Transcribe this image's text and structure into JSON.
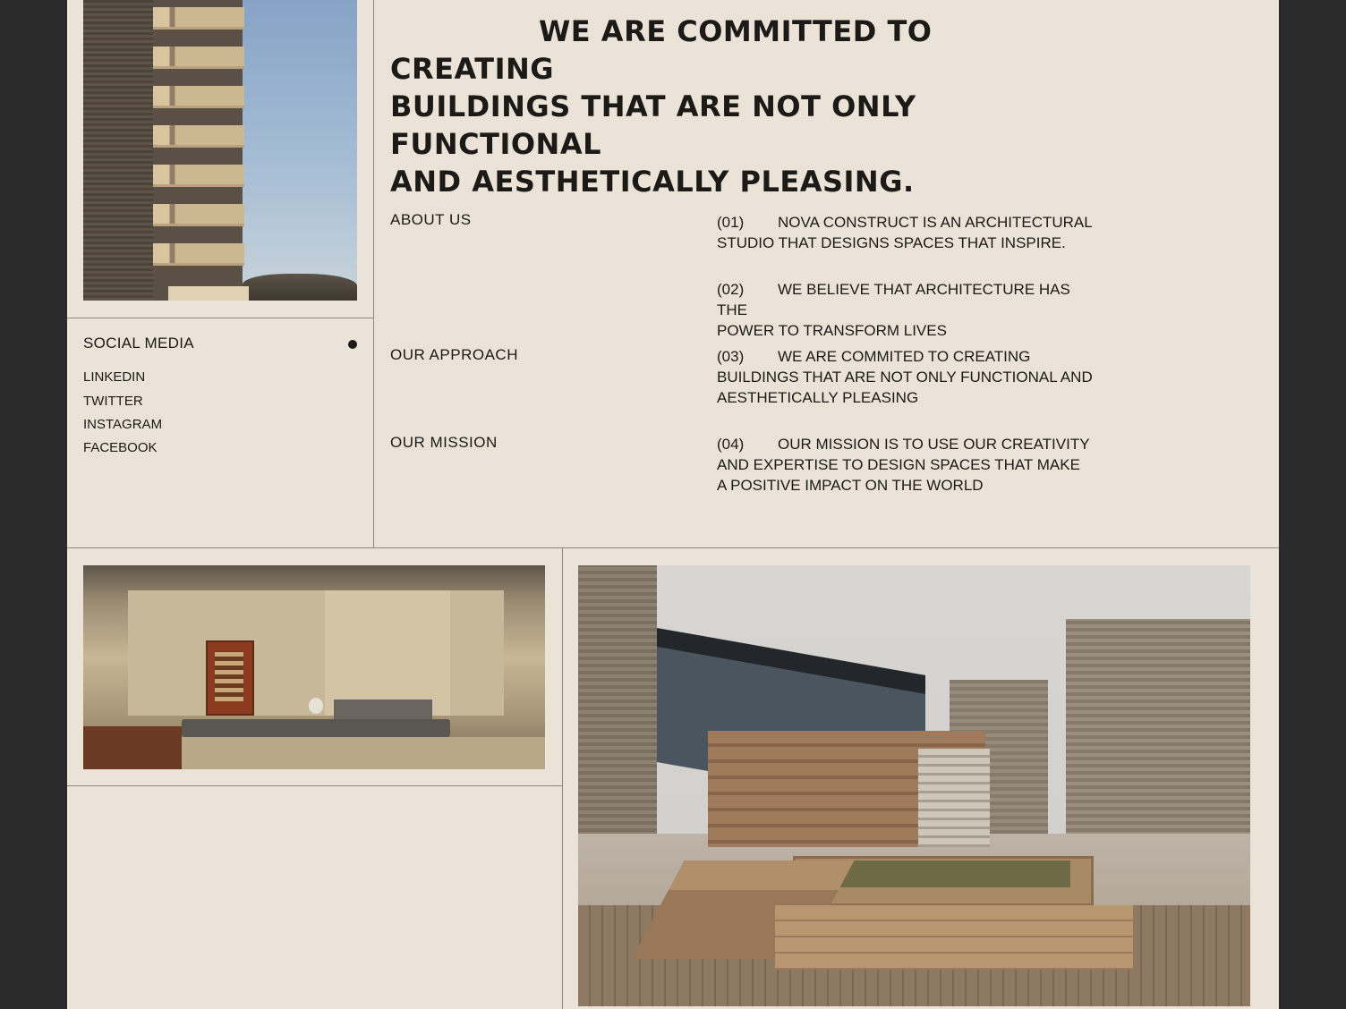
{
  "headline": {
    "line1": "WE ARE COMMITTED TO CREATING",
    "line2": "BUILDINGS THAT ARE NOT ONLY FUNCTIONAL",
    "line3": "AND AESTHETICALLY PLEASING."
  },
  "sections": {
    "about": "ABOUT US",
    "approach": "OUR APPROACH",
    "mission": "OUR MISSION"
  },
  "items": [
    {
      "num": "(01)",
      "first": "NOVA CONSTRUCT IS AN ARCHITECTURAL",
      "rest": "STUDIO THAT DESIGNS SPACES THAT INSPIRE."
    },
    {
      "num": "(02)",
      "first": "WE BELIEVE THAT ARCHITECTURE HAS THE",
      "rest": "POWER TO TRANSFORM LIVES"
    },
    {
      "num": "(03)",
      "first": "WE ARE COMMITED TO CREATING",
      "rest": "BUILDINGS THAT ARE NOT ONLY FUNCTIONAL AND AESTHETICALLY PLEASING"
    },
    {
      "num": "(04)",
      "first": "OUR MISSION IS TO USE OUR CREATIVITY",
      "rest": "AND EXPERTISE TO DESIGN SPACES THAT MAKE A POSITIVE IMPACT ON THE WORLD"
    }
  ],
  "social": {
    "title": "SOCIAL MEDIA",
    "links": [
      "LINKEDIN",
      "TWITTER",
      "INSTAGRAM",
      "FACEBOOK"
    ]
  },
  "colors": {
    "page_background": "#ebe2d8",
    "outer_background": "#2a2a2a",
    "text": "#1c1a17",
    "divider": "#8b8680"
  }
}
